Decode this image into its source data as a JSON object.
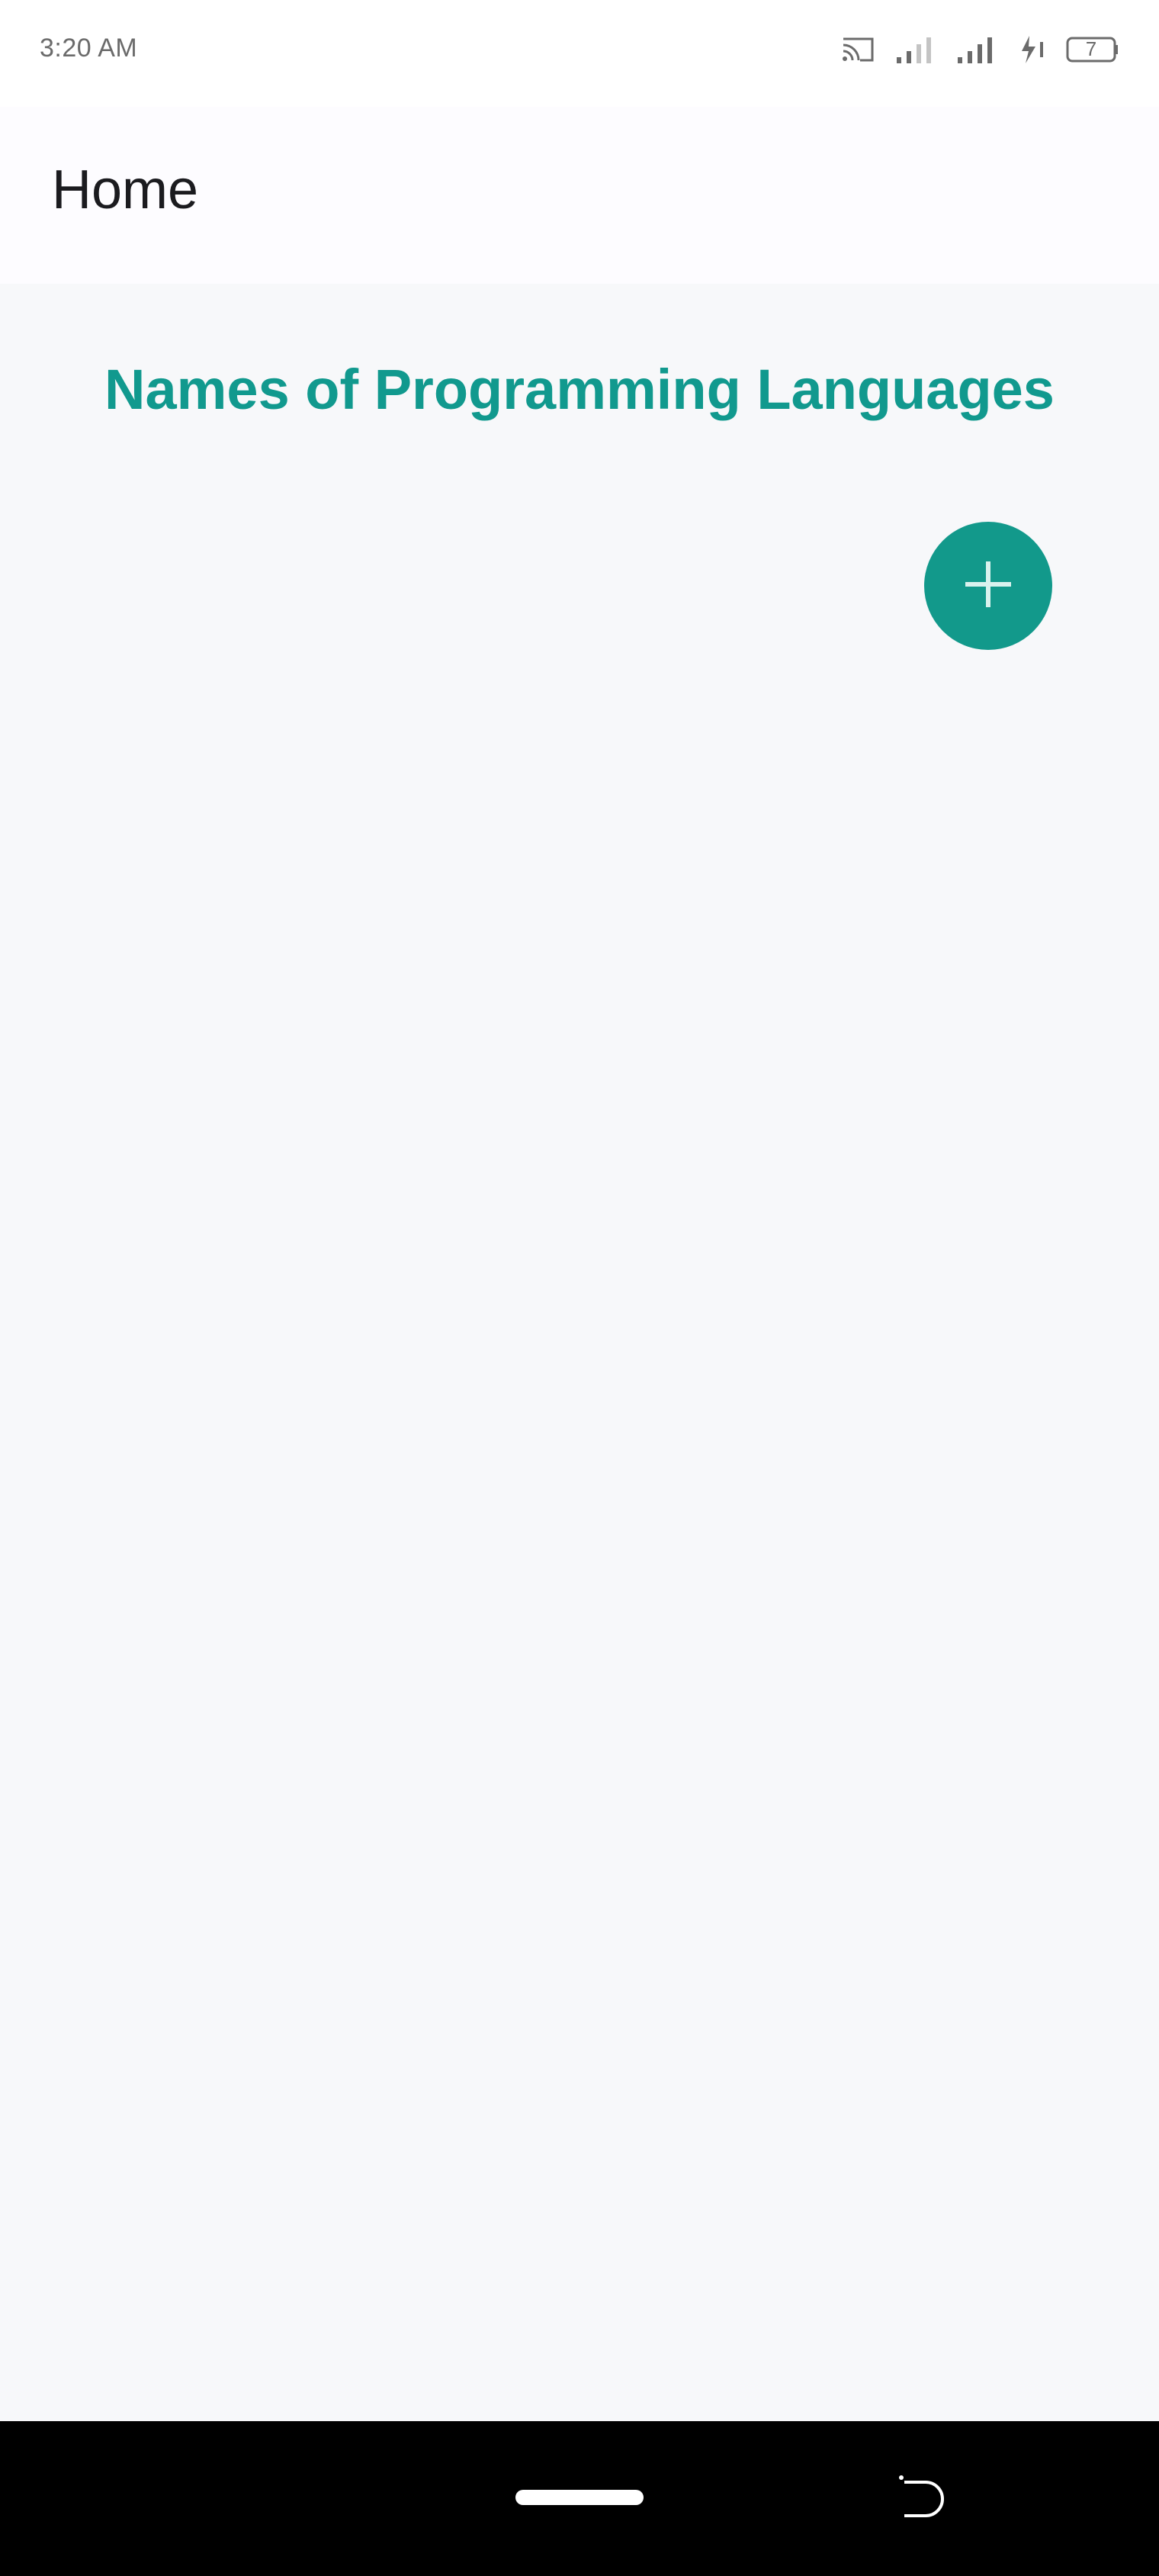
{
  "status_bar": {
    "time": "3:20 AM",
    "battery_level": "7",
    "icons": [
      "cast-icon",
      "signal-icon",
      "signal-icon",
      "charging-icon",
      "battery-icon"
    ]
  },
  "app_bar": {
    "title": "Home"
  },
  "main": {
    "heading": "Names of Programming Languages",
    "fab_icon": "plus-icon"
  },
  "nav_bar": {
    "icons": [
      "home-indicator",
      "back-gesture-icon"
    ]
  },
  "colors": {
    "accent": "#11998e",
    "background": "#f7f8fa",
    "app_bar": "#fdfcff",
    "nav_bar": "#000000"
  }
}
